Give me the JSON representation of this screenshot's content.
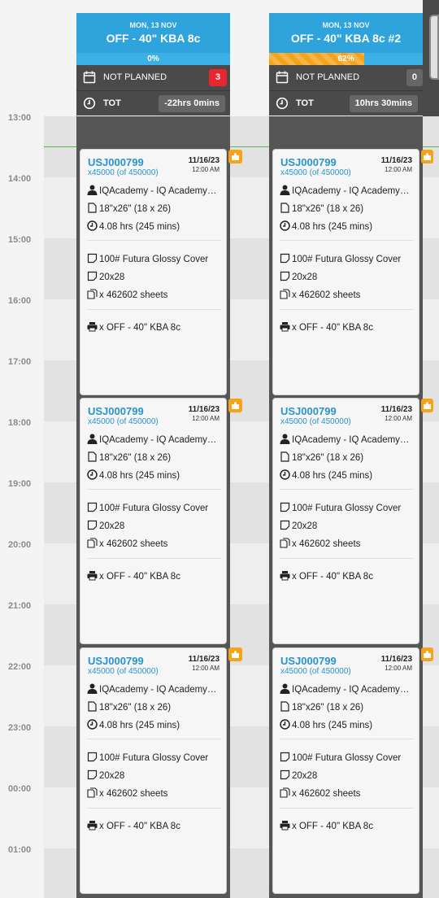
{
  "times": [
    "13:00",
    "14:00",
    "15:00",
    "16:00",
    "17:00",
    "18:00",
    "19:00",
    "20:00",
    "21:00",
    "22:00",
    "23:00",
    "00:00",
    "01:00"
  ],
  "columns": [
    {
      "date": "MON, 13 NOV",
      "title": "OFF - 40\" KBA 8c",
      "progress_label": "0%",
      "progress": 0,
      "not_planned_label": "NOT PLANNED",
      "not_planned_count": "3",
      "tot_label": "TOT",
      "tot_value": "-22hrs 0mins"
    },
    {
      "date": "MON, 13 NOV",
      "title": "OFF - 40\" KBA 8c #2",
      "progress_label": "62%",
      "progress": 62,
      "not_planned_label": "NOT PLANNED",
      "not_planned_count": "0",
      "tot_label": "TOT",
      "tot_value": "10hrs 30mins"
    }
  ],
  "job": {
    "id": "USJ000799",
    "qty": "x45000 (of 450000)",
    "date": "11/16/23",
    "time": "12:00 AM",
    "customer": "IQAcademy - IQ Academy…",
    "size": "18\"x26\" (18 x 26)",
    "duration": "4.08 hrs (245 mins)",
    "paper": "100# Futura Glossy Cover",
    "sheet_size": "20x28",
    "sheets": "x 462602 sheets",
    "press": "x OFF - 40\" KBA 8c"
  },
  "colors": {
    "header": "#2fa3dc",
    "accent": "#f6a21a",
    "alert": "#e8262f",
    "now_line": "#59b54e"
  },
  "icons": [
    "calendar-icon",
    "clock-icon",
    "user-icon",
    "page-icon",
    "clock-small-icon",
    "sheet-icon",
    "copy-icon",
    "printer-icon",
    "puzzle-icon"
  ]
}
